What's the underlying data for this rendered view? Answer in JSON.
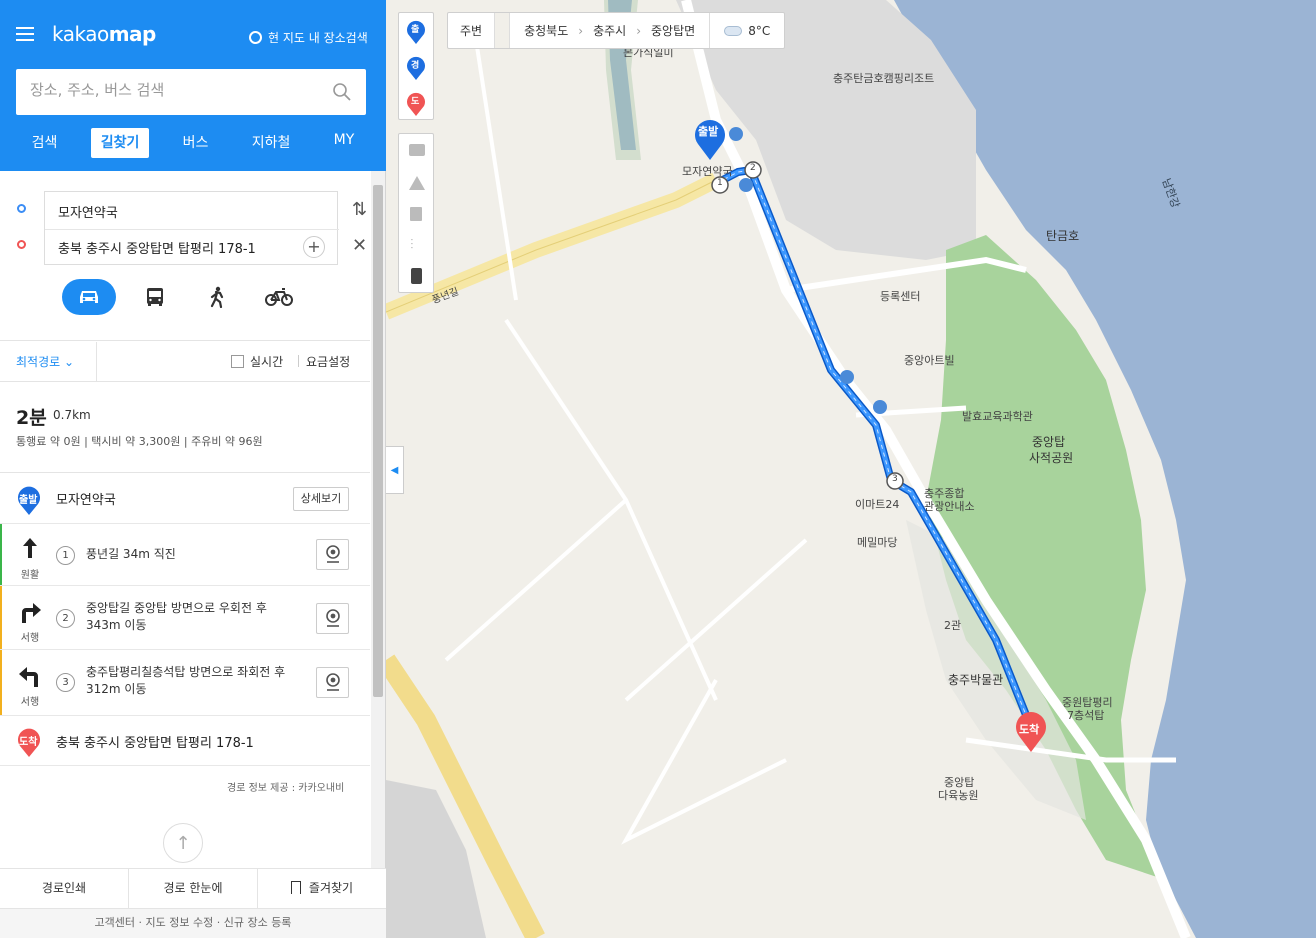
{
  "header": {
    "logo_light": "kakao",
    "logo_bold": "map",
    "area_search_label": "현 지도 내 장소검색",
    "search_placeholder": "장소, 주소, 버스 검색"
  },
  "nav_tabs": [
    {
      "label": "검색",
      "active": false
    },
    {
      "label": "길찾기",
      "active": true
    },
    {
      "label": "버스",
      "active": false
    },
    {
      "label": "지하철",
      "active": false
    },
    {
      "label": "MY",
      "active": false
    }
  ],
  "route_inputs": {
    "origin": "모자연약국",
    "destination": "충북 충주시 중앙탑면 탑평리 178-1"
  },
  "transport_modes": [
    "car-icon",
    "bus-icon",
    "walk-icon",
    "bike-icon"
  ],
  "options": {
    "route_type": "최적경로",
    "realtime_label": "실시간",
    "fee_label": "요금설정"
  },
  "summary": {
    "time": "2분",
    "distance": "0.7km",
    "costs": "통행료 약 0원  |  택시비 약 3,300원  |  주유비 약 96원"
  },
  "start": {
    "badge": "출발",
    "name": "모자연약국",
    "detail_button": "상세보기"
  },
  "steps": [
    {
      "num": "1",
      "direction": "원활",
      "text": "풍년길 34m 직진"
    },
    {
      "num": "2",
      "direction": "서행",
      "text": "중앙탑길 중앙탑 방면으로 우회전 후",
      "text2": "343m 이동"
    },
    {
      "num": "3",
      "direction": "서행",
      "text": "충주탑평리칠층석탑 방면으로 좌회전 후",
      "text2": "312m 이동"
    }
  ],
  "end": {
    "badge": "도착",
    "name": "충북 충주시 중앙탑면 탑평리 178-1"
  },
  "credit": "경로 정보 제공 : 카카오내비",
  "bottom_buttons": [
    "경로인쇄",
    "경로 한눈에",
    "즐겨찾기"
  ],
  "footer": "고객센터 · 지도 정보 수정 · 신규 장소 등록",
  "map": {
    "toolbar_pins": [
      "출",
      "경",
      "도"
    ],
    "around_label": "주변",
    "breadcrumb": [
      "충청북도",
      "충주시",
      "중앙탑면"
    ],
    "weather": "8°C",
    "labels": {
      "resort": "충주탄금호캠핑리조트",
      "river": "남한강",
      "lake": "탄금호",
      "road": "풍년길",
      "registry": "등록센터",
      "villa": "중앙아트빌",
      "science": "발효교육과학관",
      "park": "중앙탑",
      "park2": "사적공원",
      "emart": "이마트24",
      "tour": "충주종합",
      "tour2": "관광안내소",
      "food": "메밀마당",
      "hall2": "2관",
      "museum": "충주박물관",
      "pagoda": "중원탑평리",
      "pagoda2": "7층석탑",
      "farm": "중앙탑",
      "farm2": "다육농원",
      "start_place": "모자연약국",
      "top_cut": "본가식일미"
    },
    "start_pin": "출발",
    "end_pin": "도착",
    "waypoints": [
      "1",
      "2",
      "3"
    ],
    "route_color": "#1d7cf2",
    "accent": "#1d8cf2"
  }
}
